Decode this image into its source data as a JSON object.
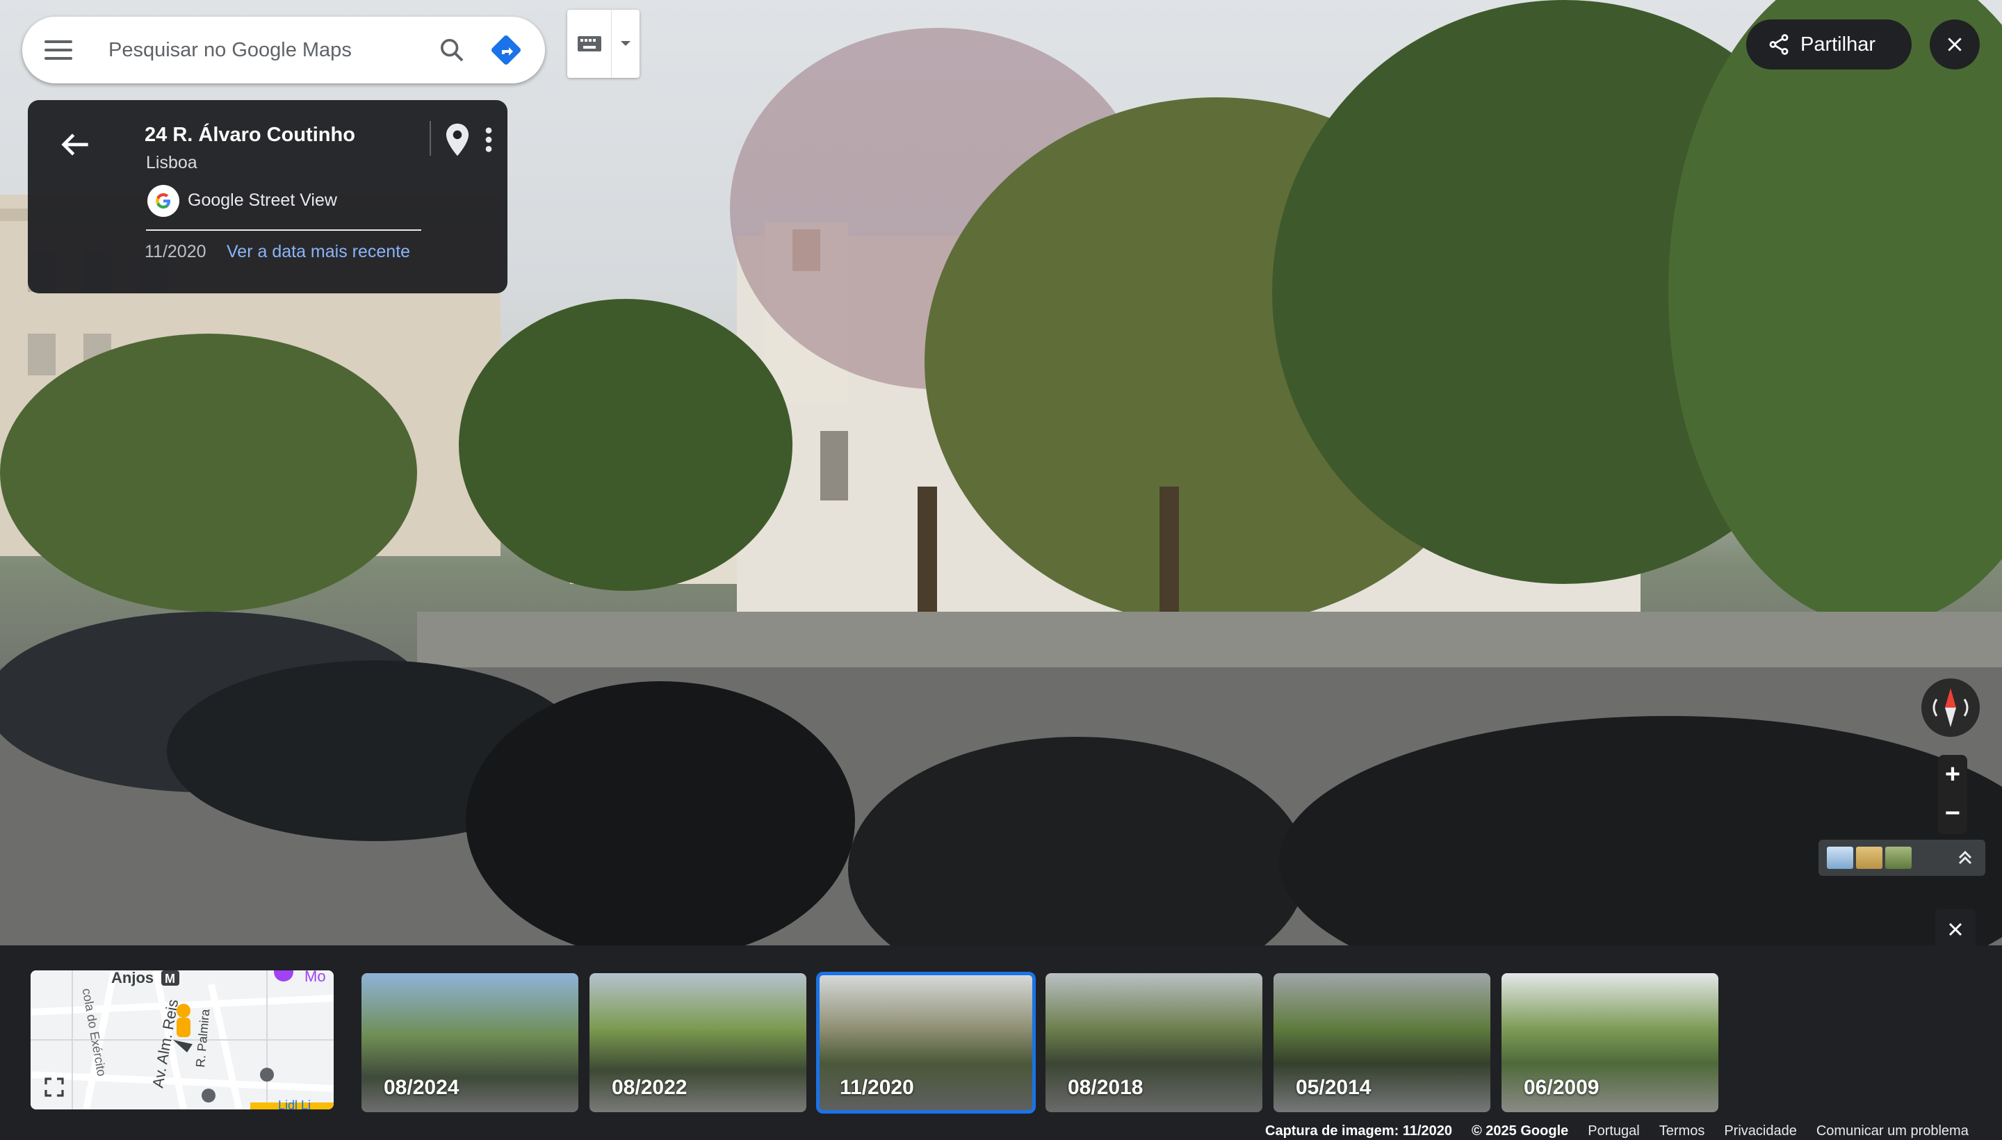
{
  "search": {
    "placeholder": "Pesquisar no Google Maps"
  },
  "card": {
    "address": "24 R. Álvaro Coutinho",
    "city": "Lisboa",
    "source": "Google Street View",
    "date": "11/2020",
    "latest_link": "Ver a data mais recente"
  },
  "share": {
    "label": "Partilhar"
  },
  "map": {
    "labels": [
      "Anjos",
      "M",
      "Mo",
      "cola do Exército",
      "Av. Alm. Reis",
      "R. Palmira",
      "Lidl Li"
    ]
  },
  "timeline": [
    {
      "label": "08/2024",
      "selected": false
    },
    {
      "label": "08/2022",
      "selected": false
    },
    {
      "label": "11/2020",
      "selected": true
    },
    {
      "label": "08/2018",
      "selected": false
    },
    {
      "label": "05/2014",
      "selected": false
    },
    {
      "label": "06/2009",
      "selected": false
    }
  ],
  "footer": {
    "capture": "Captura de imagem: 11/2020",
    "copyright": "© 2025 Google",
    "links": [
      "Portugal",
      "Termos",
      "Privacidade",
      "Comunicar um problema"
    ]
  },
  "colors": {
    "accent": "#1a73e8",
    "panel": "#202124",
    "link": "#8ab4f8"
  },
  "icons": [
    "menu-icon",
    "search-icon",
    "directions-icon",
    "keyboard-icon",
    "back-arrow-icon",
    "pin-icon",
    "more-vert-icon",
    "google-logo-icon",
    "share-icon",
    "close-icon",
    "compass-icon",
    "zoom-in-icon",
    "zoom-out-icon",
    "layers-chevron-icon",
    "expand-icon",
    "pegman-icon"
  ]
}
